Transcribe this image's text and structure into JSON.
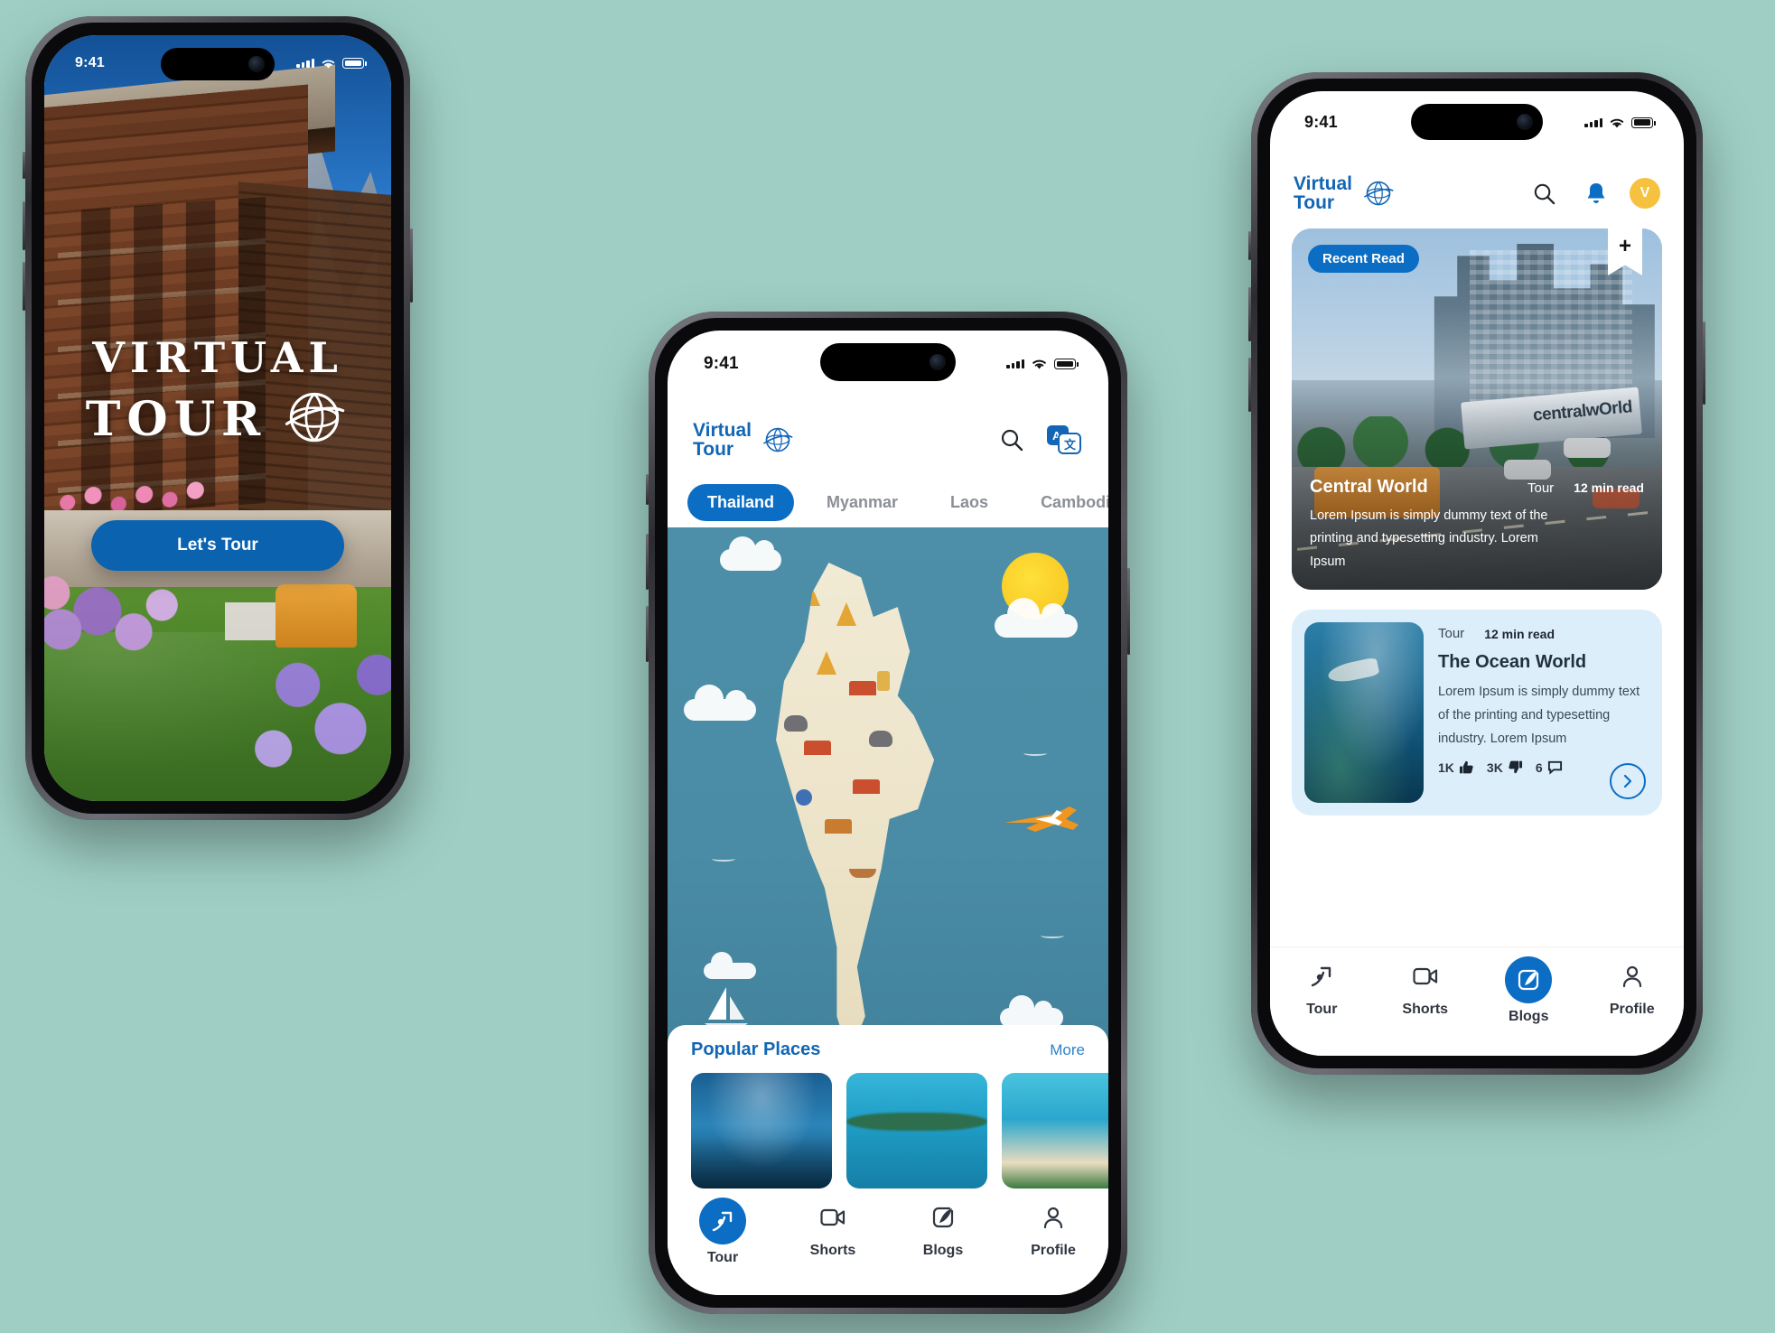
{
  "splash": {
    "status": {
      "time": "9:41"
    },
    "logo_line1": "VIRTUAL",
    "logo_line2": "TOUR",
    "globe_icon": "globe-icon",
    "cta_label": "Let's Tour"
  },
  "tour": {
    "status": {
      "time": "9:41"
    },
    "brand": {
      "line1": "Virtual",
      "line2": "Tour",
      "globe_icon": "globe-icon"
    },
    "actions": [
      {
        "name": "search-icon",
        "label": "Search"
      },
      {
        "name": "translate-icon",
        "label": "Translate"
      }
    ],
    "tabs": [
      {
        "label": "Thailand",
        "active": true
      },
      {
        "label": "Myanmar",
        "active": false
      },
      {
        "label": "Laos",
        "active": false
      },
      {
        "label": "Cambodia",
        "active": false
      }
    ],
    "map": {
      "region": "Thailand",
      "alt": "Illustrated map of Thailand"
    },
    "popular": {
      "title": "Popular Places",
      "more_label": "More",
      "places": [
        {
          "name": "aquarium-tunnel"
        },
        {
          "name": "overwater-bungalows"
        },
        {
          "name": "tropical-beach"
        }
      ]
    },
    "bottom_nav": [
      {
        "label": "Tour",
        "icon": "route-arrow-icon",
        "active": true
      },
      {
        "label": "Shorts",
        "icon": "video-camera-icon",
        "active": false
      },
      {
        "label": "Blogs",
        "icon": "feather-pen-icon",
        "active": false
      },
      {
        "label": "Profile",
        "icon": "person-icon",
        "active": false
      }
    ]
  },
  "blogs": {
    "status": {
      "time": "9:41"
    },
    "brand": {
      "line1": "Virtual",
      "line2": "Tour",
      "globe_icon": "globe-icon"
    },
    "actions": [
      {
        "name": "search-icon",
        "label": "Search"
      },
      {
        "name": "bell-icon",
        "label": "Notifications"
      }
    ],
    "avatar_initial": "V",
    "hero": {
      "badge": "Recent Read",
      "bookmark_icon": "bookmark-plus-icon",
      "sign_text": "centralwOrld",
      "title": "Central World",
      "category": "Tour",
      "read_time": "12 min read",
      "description": "Lorem Ipsum is simply dummy text of the printing and typesetting industry. Lorem Ipsum"
    },
    "card": {
      "category": "Tour",
      "read_time": "12 min read",
      "title": "The Ocean World",
      "description": "Lorem Ipsum is simply dummy text of the printing and typesetting industry. Lorem Ipsum",
      "stats": [
        {
          "value": "1K",
          "icon": "thumbs-up-icon"
        },
        {
          "value": "3K",
          "icon": "thumbs-down-icon"
        },
        {
          "value": "6",
          "icon": "comment-icon"
        }
      ],
      "next_icon": "chevron-right-icon"
    },
    "bottom_nav": [
      {
        "label": "Tour",
        "icon": "route-arrow-icon",
        "active": false
      },
      {
        "label": "Shorts",
        "icon": "video-camera-icon",
        "active": false
      },
      {
        "label": "Blogs",
        "icon": "feather-pen-icon",
        "active": true
      },
      {
        "label": "Profile",
        "icon": "person-icon",
        "active": false
      }
    ]
  },
  "colors": {
    "brand_blue": "#0b6ec4",
    "brand_blue_dark": "#1266b5",
    "avatar_yellow": "#f6c13f",
    "card_bg": "#ddeefb",
    "background": "#9fcfc4"
  }
}
